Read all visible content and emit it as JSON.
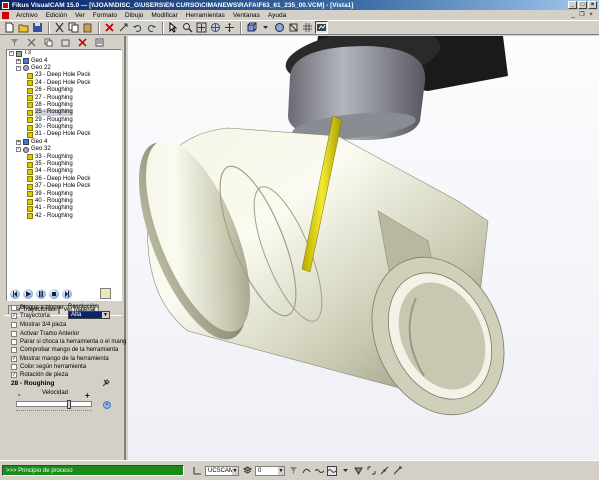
{
  "window": {
    "title": "Fikus VisualCAM 15.0 — [\\\\JOAN\\DISC_G\\USERS\\EN CURSO\\CIMANEWS\\RAFA\\F63_61_235_00.VCM] - [Vista1]",
    "minimize": "_",
    "maximize": "□",
    "close": "×"
  },
  "menu": {
    "items": [
      "Archivo",
      "Edición",
      "Ver",
      "Formato",
      "Dibujo",
      "Modificar",
      "Herramientas",
      "Ventanas",
      "Ayuda"
    ],
    "mdi_minimize": "_",
    "mdi_restore": "❐",
    "mdi_close": "×"
  },
  "tree": {
    "root": "T3",
    "nodes": [
      {
        "label": "Geo 4",
        "kind": "geo",
        "level": 1,
        "expander": "+"
      },
      {
        "label": "Geo 22",
        "kind": "geo-gray",
        "level": 1,
        "expander": "-"
      },
      {
        "label": "23 - Deep Hole Peck",
        "kind": "op",
        "level": 2
      },
      {
        "label": "24 - Deep Hole Peck",
        "kind": "op",
        "level": 2
      },
      {
        "label": "26 - Roughing",
        "kind": "op",
        "level": 2
      },
      {
        "label": "27 - Roughing",
        "kind": "op",
        "level": 2
      },
      {
        "label": "28 - Roughing",
        "kind": "op",
        "level": 2
      },
      {
        "label": "25 - Roughing",
        "kind": "op",
        "level": 2,
        "selected": true
      },
      {
        "label": "29 - Roughing",
        "kind": "op",
        "level": 2
      },
      {
        "label": "30 - Roughing",
        "kind": "op",
        "level": 2
      },
      {
        "label": "31 - Deep Hole Peck",
        "kind": "op",
        "level": 2
      },
      {
        "label": "Geo 4",
        "kind": "geo",
        "level": 1,
        "expander": "+"
      },
      {
        "label": "Geo 32",
        "kind": "geo-gray",
        "level": 1,
        "expander": "-"
      },
      {
        "label": "33 - Roughing",
        "kind": "op",
        "level": 2
      },
      {
        "label": "35 - Roughing",
        "kind": "op",
        "level": 2
      },
      {
        "label": "34 - Roughing",
        "kind": "op",
        "level": 2
      },
      {
        "label": "36 - Deep Hole Peck",
        "kind": "op",
        "level": 2
      },
      {
        "label": "37 - Deep Hole Peck",
        "kind": "op",
        "level": 2
      },
      {
        "label": "39 - Roughing",
        "kind": "op",
        "level": 2
      },
      {
        "label": "40 - Roughing",
        "kind": "op",
        "level": 2
      },
      {
        "label": "41 - Roughing",
        "kind": "op",
        "level": 2
      },
      {
        "label": "42 - Roughing",
        "kind": "op",
        "level": 2
      }
    ]
  },
  "panel": {
    "tabs": [
      "Ver Trayectorias",
      "Ver Material"
    ],
    "active_tab": 1,
    "resolution_label": "Resolución:",
    "resolution_value": "Alta",
    "checkboxes": [
      {
        "label": "Bloque a bloque",
        "checked": false
      },
      {
        "label": "Trayectoria",
        "checked": true
      },
      {
        "label": "Mostrar 3/4 pieza",
        "checked": false
      },
      {
        "label": "Activar Tramo Anterior",
        "checked": false
      },
      {
        "label": "Parar si choca la herramienta o el mang",
        "checked": false
      },
      {
        "label": "Comprobar mango de la herramienta",
        "checked": false
      },
      {
        "label": "Mostrar mango de la herramienta",
        "checked": true
      },
      {
        "label": "Color según herramienta",
        "checked": false
      },
      {
        "label": "Rotación de pieza",
        "checked": true
      }
    ],
    "current_operation": "28 - Roughing",
    "speed_label": "Velocidad",
    "speed_minus": "-",
    "speed_plus": "+",
    "speed_level": 0.7
  },
  "status": {
    "process": ">>> Principio de proceso",
    "ucs": "UCSCAM",
    "layer": "0"
  },
  "colors": {
    "tool": "#e6d800",
    "part": "#dcdcc4",
    "status_green": "#1a8a1a"
  }
}
